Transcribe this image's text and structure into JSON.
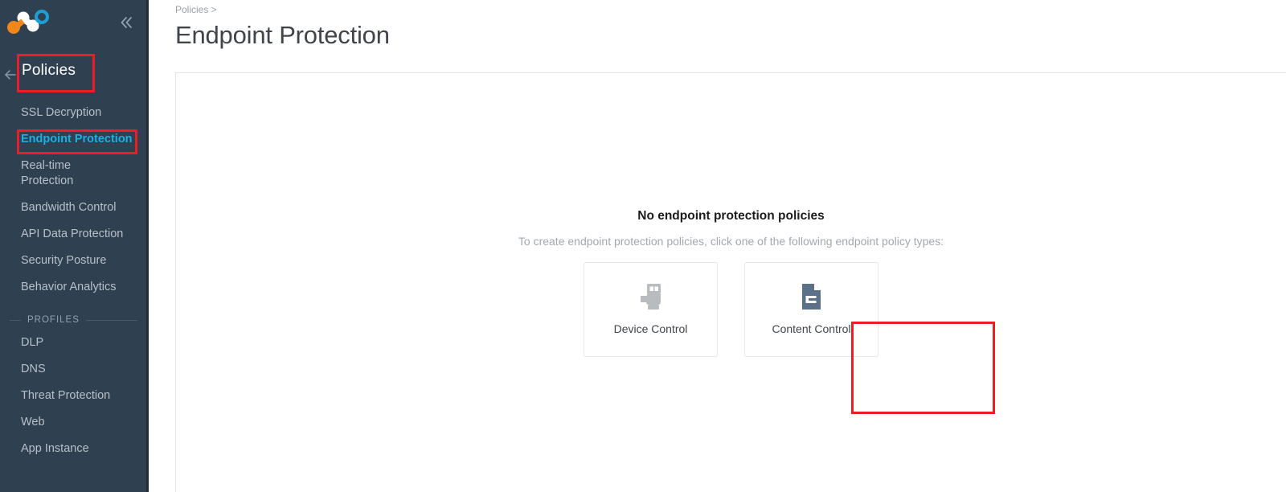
{
  "app": {
    "logo_name": "molecule-logo",
    "accent_blue": "#18b0e8",
    "sidebar_bg": "#2f4050",
    "highlight_red": "#ee1c25"
  },
  "sidebar": {
    "collapse_label": "«",
    "section_title": "Policies",
    "items": [
      {
        "label": "SSL Decryption",
        "active": false
      },
      {
        "label": "Endpoint Protection",
        "active": true
      },
      {
        "label": "Real-time\nProtection",
        "active": false
      },
      {
        "label": "Bandwidth Control",
        "active": false
      },
      {
        "label": "API Data Protection",
        "active": false
      },
      {
        "label": "Security Posture",
        "active": false
      },
      {
        "label": "Behavior Analytics",
        "active": false
      }
    ],
    "profiles_label": "PROFILES",
    "profiles": [
      {
        "label": "DLP"
      },
      {
        "label": "DNS"
      },
      {
        "label": "Threat Protection"
      },
      {
        "label": "Web"
      },
      {
        "label": "App Instance"
      }
    ]
  },
  "header": {
    "breadcrumb": "Policies >",
    "title": "Endpoint Protection"
  },
  "empty_state": {
    "title": "No endpoint protection policies",
    "subtitle": "To create endpoint protection policies, click one of the following endpoint policy types:",
    "cards": [
      {
        "label": "Device Control",
        "icon": "usb-drive-icon"
      },
      {
        "label": "Content Control",
        "icon": "document-icon"
      }
    ]
  }
}
